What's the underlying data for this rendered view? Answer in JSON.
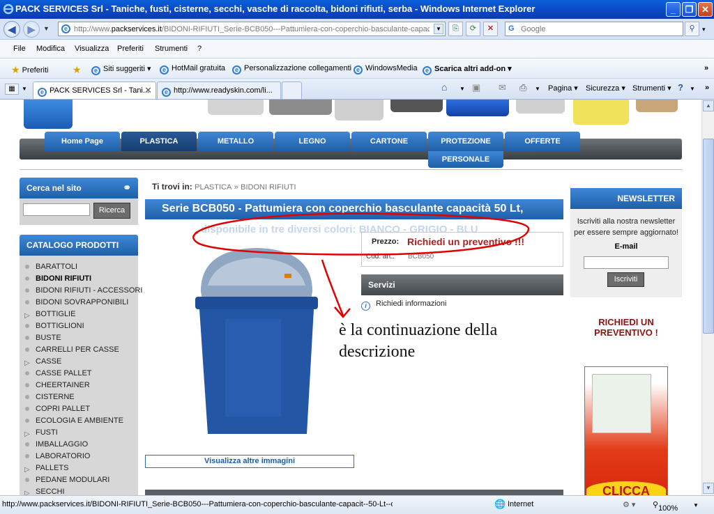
{
  "window": {
    "title": "PACK SERVICES Srl - Taniche, fusti, cisterne, secchi, vasche di raccolta, bidoni rifiuti, serba - Windows Internet Explorer"
  },
  "address": {
    "url_prefix": "http://www.",
    "url_domain": "packservices.it",
    "url_rest": "/BIDONI-RIFIUTI_Serie-BCB050---Pattumiera-con-coperchio-basculante-capaci",
    "search_placeholder": "Google"
  },
  "menu": [
    "File",
    "Modifica",
    "Visualizza",
    "Preferiti",
    "Strumenti",
    "?"
  ],
  "favorites": {
    "label": "Preferiti",
    "items": [
      "Siti suggeriti ▾",
      "HotMail gratuita",
      "Personalizzazione collegamenti",
      "WindowsMedia",
      "Scarica altri add-on ▾"
    ]
  },
  "tabs": [
    {
      "label": "PACK SERVICES Srl - Tani..."
    },
    {
      "label": "http://www.readyskin.com/li..."
    }
  ],
  "commandbar": [
    "Pagina ▾",
    "Sicurezza ▾",
    "Strumenti ▾"
  ],
  "site": {
    "nav": [
      "Home Page",
      "PLASTICA",
      "METALLO",
      "LEGNO",
      "CARTONE",
      "PROTEZIONE",
      "OFFERTE"
    ],
    "nav_sub": "PERSONALE",
    "search_title": "Cerca nel sito",
    "search_button": "Ricerca",
    "catalog_title": "CATALOGO PRODOTTI",
    "catalog": [
      {
        "label": "BARATTOLI",
        "type": "dot"
      },
      {
        "label": "BIDONI RIFIUTI",
        "type": "dot",
        "bold": true
      },
      {
        "label": "BIDONI RIFIUTI - ACCESSORI",
        "type": "dot"
      },
      {
        "label": "BIDONI SOVRAPPONIBILI",
        "type": "dot"
      },
      {
        "label": "BOTTIGLIE",
        "type": "tri"
      },
      {
        "label": "BOTTIGLIONI",
        "type": "dot"
      },
      {
        "label": "BUSTE",
        "type": "dot"
      },
      {
        "label": "CARRELLI PER CASSE",
        "type": "dot"
      },
      {
        "label": "CASSE",
        "type": "tri"
      },
      {
        "label": "CASSE PALLET",
        "type": "dot"
      },
      {
        "label": "CHEERTAINER",
        "type": "dot"
      },
      {
        "label": "CISTERNE",
        "type": "dot"
      },
      {
        "label": "COPRI PALLET",
        "type": "dot"
      },
      {
        "label": "ECOLOGIA E AMBIENTE",
        "type": "dot"
      },
      {
        "label": "FUSTI",
        "type": "tri"
      },
      {
        "label": "IMBALLAGGIO",
        "type": "dot"
      },
      {
        "label": "LABORATORIO",
        "type": "dot"
      },
      {
        "label": "PALLETS",
        "type": "tri"
      },
      {
        "label": "PEDANE MODULARI",
        "type": "dot"
      },
      {
        "label": "SECCHI",
        "type": "tri"
      }
    ],
    "breadcrumb_prefix": "Ti trovi in:",
    "breadcrumb": [
      "PLASTICA",
      "BIDONI RIFIUTI"
    ],
    "breadcrumb_sep": "»",
    "product_title": "Serie BCB050 - Pattumiera con coperchio basculante capacità 50 Lt,",
    "description": "disponibile in tre diversi colori: BIANCO - GRIGIO - BLU",
    "price_label": "Prezzo:",
    "price_value": "Richiedi un preventivo !!!",
    "code_label": "Cod. art.:",
    "code_value": "BCB050",
    "services_title": "Servizi",
    "services_item": "Richiedi informazioni",
    "annotation_line1": "è la continuazione della",
    "annotation_line2": "descrizione",
    "more_images": "Visualizza altre immagini",
    "newsletter_title": "NEWSLETTER",
    "newsletter_text": "Iscriviti alla nostra newsletter per essere sempre aggiornato!",
    "email_label": "E-mail",
    "subscribe_button": "Iscriviti",
    "quote_line1": "RICHIEDI UN",
    "quote_line2": "PREVENTIVO !",
    "banner_text": "CLICCA"
  },
  "status": {
    "url": "http://www.packservices.it/BIDONI-RIFIUTI_Serie-BCB050---Pattumiera-con-coperchio-basculante-capacit--50-Lt--d",
    "zone": "Internet",
    "zoom": "100%"
  },
  "colors": {
    "titlebar": "#0b47c4",
    "nav_blue": "#1f5fa8",
    "annotation_red": "#e00000",
    "price_red": "#b02020"
  }
}
